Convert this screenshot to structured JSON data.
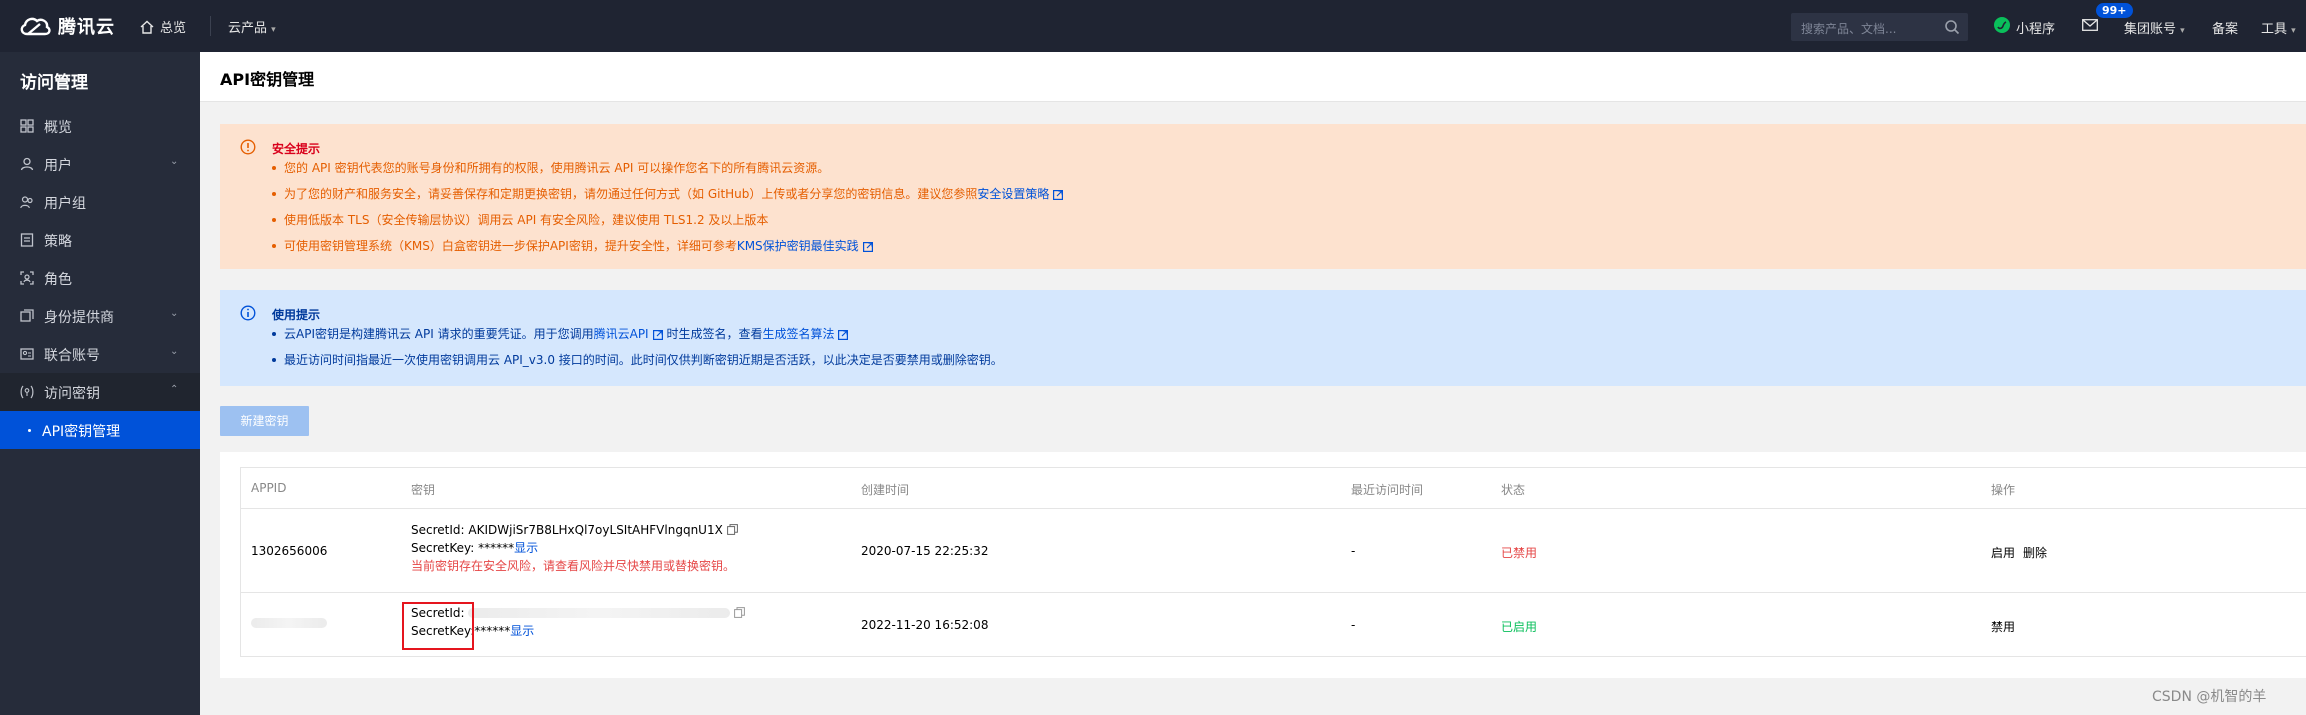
{
  "topbar": {
    "brand": "腾讯云",
    "home_label": "总览",
    "products_label": "云产品",
    "search_placeholder": "搜索产品、文档...",
    "miniprogram_label": "小程序",
    "mail_badge": "99+",
    "account_label": "集团账号",
    "record_label": "备案",
    "tools_label": "工具"
  },
  "sidebar": {
    "title": "访问管理",
    "items": [
      {
        "label": "概览",
        "icon": "grid-icon"
      },
      {
        "label": "用户",
        "icon": "user-icon",
        "chevron": "down"
      },
      {
        "label": "用户组",
        "icon": "users-icon"
      },
      {
        "label": "策略",
        "icon": "policy-icon"
      },
      {
        "label": "角色",
        "icon": "role-icon"
      },
      {
        "label": "身份提供商",
        "icon": "identity-icon",
        "chevron": "down"
      },
      {
        "label": "联合账号",
        "icon": "account-icon",
        "chevron": "down"
      },
      {
        "label": "访问密钥",
        "icon": "key-icon",
        "chevron": "up"
      },
      {
        "label": "API密钥管理",
        "active": true
      }
    ]
  },
  "page": {
    "title": "API密钥管理"
  },
  "security_notice": {
    "title": "安全提示",
    "items": [
      {
        "text": "您的 API 密钥代表您的账号身份和所拥有的权限，使用腾讯云 API 可以操作您名下的所有腾讯云资源。"
      },
      {
        "text": "为了您的财产和服务安全，请妥善保存和定期更换密钥，请勿通过任何方式（如 GitHub）上传或者分享您的密钥信息。建议您参照",
        "link": "安全设置策略"
      },
      {
        "text": "使用低版本 TLS（安全传输层协议）调用云 API 有安全风险，建议使用 TLS1.2 及以上版本"
      },
      {
        "text": "可使用密钥管理系统（KMS）白盒密钥进一步保护API密钥，提升安全性，详细可参考",
        "link": "KMS保护密钥最佳实践"
      }
    ]
  },
  "usage_notice": {
    "title": "使用提示",
    "item1_pre": "云API密钥是构建腾讯云 API 请求的重要凭证。用于您调用",
    "item1_link1": "腾讯云API",
    "item1_mid": "时生成签名，查看",
    "item1_link2": "生成签名算法",
    "item2": "最近访问时间指最近一次使用密钥调用云 API_v3.0 接口的时间。此时间仅供判断密钥近期是否活跃，以此决定是否要禁用或删除密钥。"
  },
  "new_key_button": "新建密钥",
  "table": {
    "headers": [
      "APPID",
      "密钥",
      "创建时间",
      "最近访问时间",
      "状态",
      "操作"
    ],
    "rows": [
      {
        "appid": "1302656006",
        "secret_id_label": "SecretId:",
        "secret_id": "AKIDWjiSr7B8LHxQl7oyLSItAHFVlngqnU1X",
        "secret_key_label": "SecretKey:",
        "secret_key_mask": "******",
        "show_label": "显示",
        "warning": "当前密钥存在安全风险，请查看风险并尽快禁用或替换密钥。",
        "created": "2020-07-15 22:25:32",
        "last_access": "-",
        "status": "已禁用",
        "action1": "启用",
        "action2": "删除"
      },
      {
        "secret_id_label": "SecretId:",
        "secret_key_label": "SecretKey:",
        "secret_key_mask": "******",
        "show_label": "显示",
        "created": "2022-11-20 16:52:08",
        "last_access": "-",
        "status": "已启用",
        "action1": "禁用"
      }
    ]
  },
  "watermark": "CSDN @机智的羊"
}
